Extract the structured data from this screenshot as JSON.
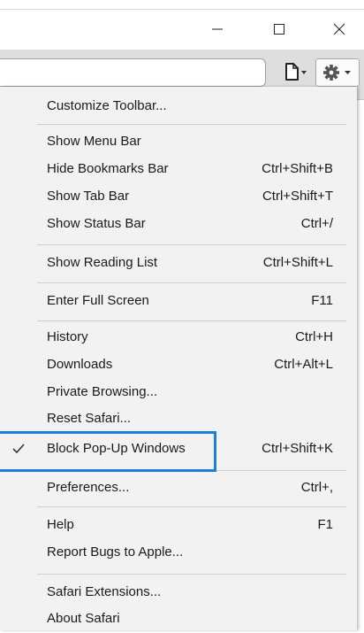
{
  "window": {
    "minimize": "minimize-icon",
    "maximize": "maximize-icon",
    "close": "close-icon"
  },
  "toolbar": {
    "page_button": "page-icon",
    "settings_button": "gear-icon"
  },
  "menu": {
    "customize_toolbar": "Customize Toolbar...",
    "show_menu_bar": "Show Menu Bar",
    "hide_bookmarks_bar": {
      "label": "Hide Bookmarks Bar",
      "shortcut": "Ctrl+Shift+B"
    },
    "show_tab_bar": {
      "label": "Show Tab Bar",
      "shortcut": "Ctrl+Shift+T"
    },
    "show_status_bar": {
      "label": "Show Status Bar",
      "shortcut": "Ctrl+/"
    },
    "show_reading_list": {
      "label": "Show Reading List",
      "shortcut": "Ctrl+Shift+L"
    },
    "enter_full_screen": {
      "label": "Enter Full Screen",
      "shortcut": "F11"
    },
    "history": {
      "label": "History",
      "shortcut": "Ctrl+H"
    },
    "downloads": {
      "label": "Downloads",
      "shortcut": "Ctrl+Alt+L"
    },
    "private_browsing": "Private Browsing...",
    "reset_safari": "Reset Safari...",
    "block_popups": {
      "label": "Block Pop-Up Windows",
      "shortcut": "Ctrl+Shift+K",
      "checked": true
    },
    "preferences": {
      "label": "Preferences...",
      "shortcut": "Ctrl+,"
    },
    "help": {
      "label": "Help",
      "shortcut": "F1"
    },
    "report_bugs": "Report Bugs to Apple...",
    "safari_extensions": "Safari Extensions...",
    "about_safari": "About Safari"
  },
  "colors": {
    "highlight_border": "#1b7fe0",
    "menu_bg": "#f2f2f2",
    "toolbar_bg": "#dedede"
  }
}
